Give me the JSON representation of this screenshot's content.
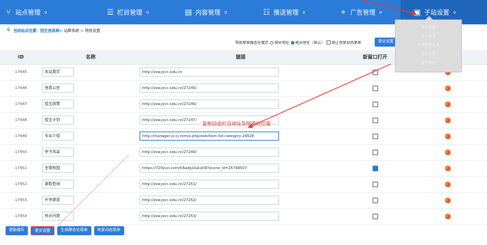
{
  "nav": [
    {
      "icon": "sitemap-icon",
      "label": "站点管理"
    },
    {
      "icon": "menu-icon",
      "label": "栏目管理"
    },
    {
      "icon": "content-icon",
      "label": "内容管理"
    },
    {
      "icon": "push-icon",
      "label": "推送管理"
    },
    {
      "icon": "ad-icon",
      "label": "广告管理"
    },
    {
      "icon": "monitor-icon",
      "label": "子站设置"
    }
  ],
  "breadcrumb": {
    "current_label": "当前站点位置：招生信息网",
    "path": " > 站群系统 > 导航设置"
  },
  "toolbar": {
    "mode_label": "导航菜单静态化模式",
    "opt_relative": "相对地址",
    "opt_absolute": "绝对地址（默认）",
    "opt_disable": "禁止恢复动态菜单",
    "submit_label": "提交设置"
  },
  "table": {
    "headers": [
      "ID",
      "名称",
      "链接",
      "新窗口打开",
      ""
    ],
    "rows": [
      {
        "id": "17445",
        "name": "本站首页",
        "link": "http://zsw.jxcc.edu.cn",
        "new_window": false
      },
      {
        "id": "17446",
        "name": "信息公告",
        "link": "http://zsw.jxcc.edu.cn/27245/",
        "new_window": false
      },
      {
        "id": "17447",
        "name": "招生政策",
        "link": "http://zsw.jxcc.edu.cn/27246/",
        "new_window": false
      },
      {
        "id": "17448",
        "name": "招生计划",
        "link": "http://zsw.jxcc.edu.cn/27247/",
        "new_window": false
      },
      {
        "id": "17449",
        "name": "专业介绍",
        "link": "http://manager.js-cj.com/s.php/zsw/item-list-category-29028",
        "new_window": false
      },
      {
        "id": "17450",
        "name": "学子风采",
        "link": "http://zsw.jxcc.edu.cn/27249/",
        "new_window": false
      },
      {
        "id": "17451",
        "name": "全景校园",
        "link": "https://720yun.com/t/6adju0ukxO9?scene_id=25798507",
        "new_window": true
      },
      {
        "id": "17452",
        "name": "录取查询",
        "link": "http://zsw.jxcc.edu.cn/27251/",
        "new_window": false
      },
      {
        "id": "17453",
        "name": "升学渠道",
        "link": "http://zsw.jxcc.edu.cn/27252/",
        "new_window": false
      },
      {
        "id": "17454",
        "name": "热点问题",
        "link": "http://zsw.jxcc.edu.cn/27253/",
        "new_window": false
      }
    ]
  },
  "annotation": "复制动态栏目地址到所需的位置",
  "buttons": {
    "update": "更新缓存",
    "submit": "提交设置",
    "gen_static": "生成静态化菜单",
    "restore": "恢复动态菜单"
  },
  "dropdown": [
    "基本设置",
    "首页设置",
    "导航菜单设置",
    "首页标签",
    "首页静态"
  ],
  "colors": {
    "nav_bg": "#2b7bd8",
    "annotation": "#e53935",
    "status_dot": "#ee5a24"
  }
}
